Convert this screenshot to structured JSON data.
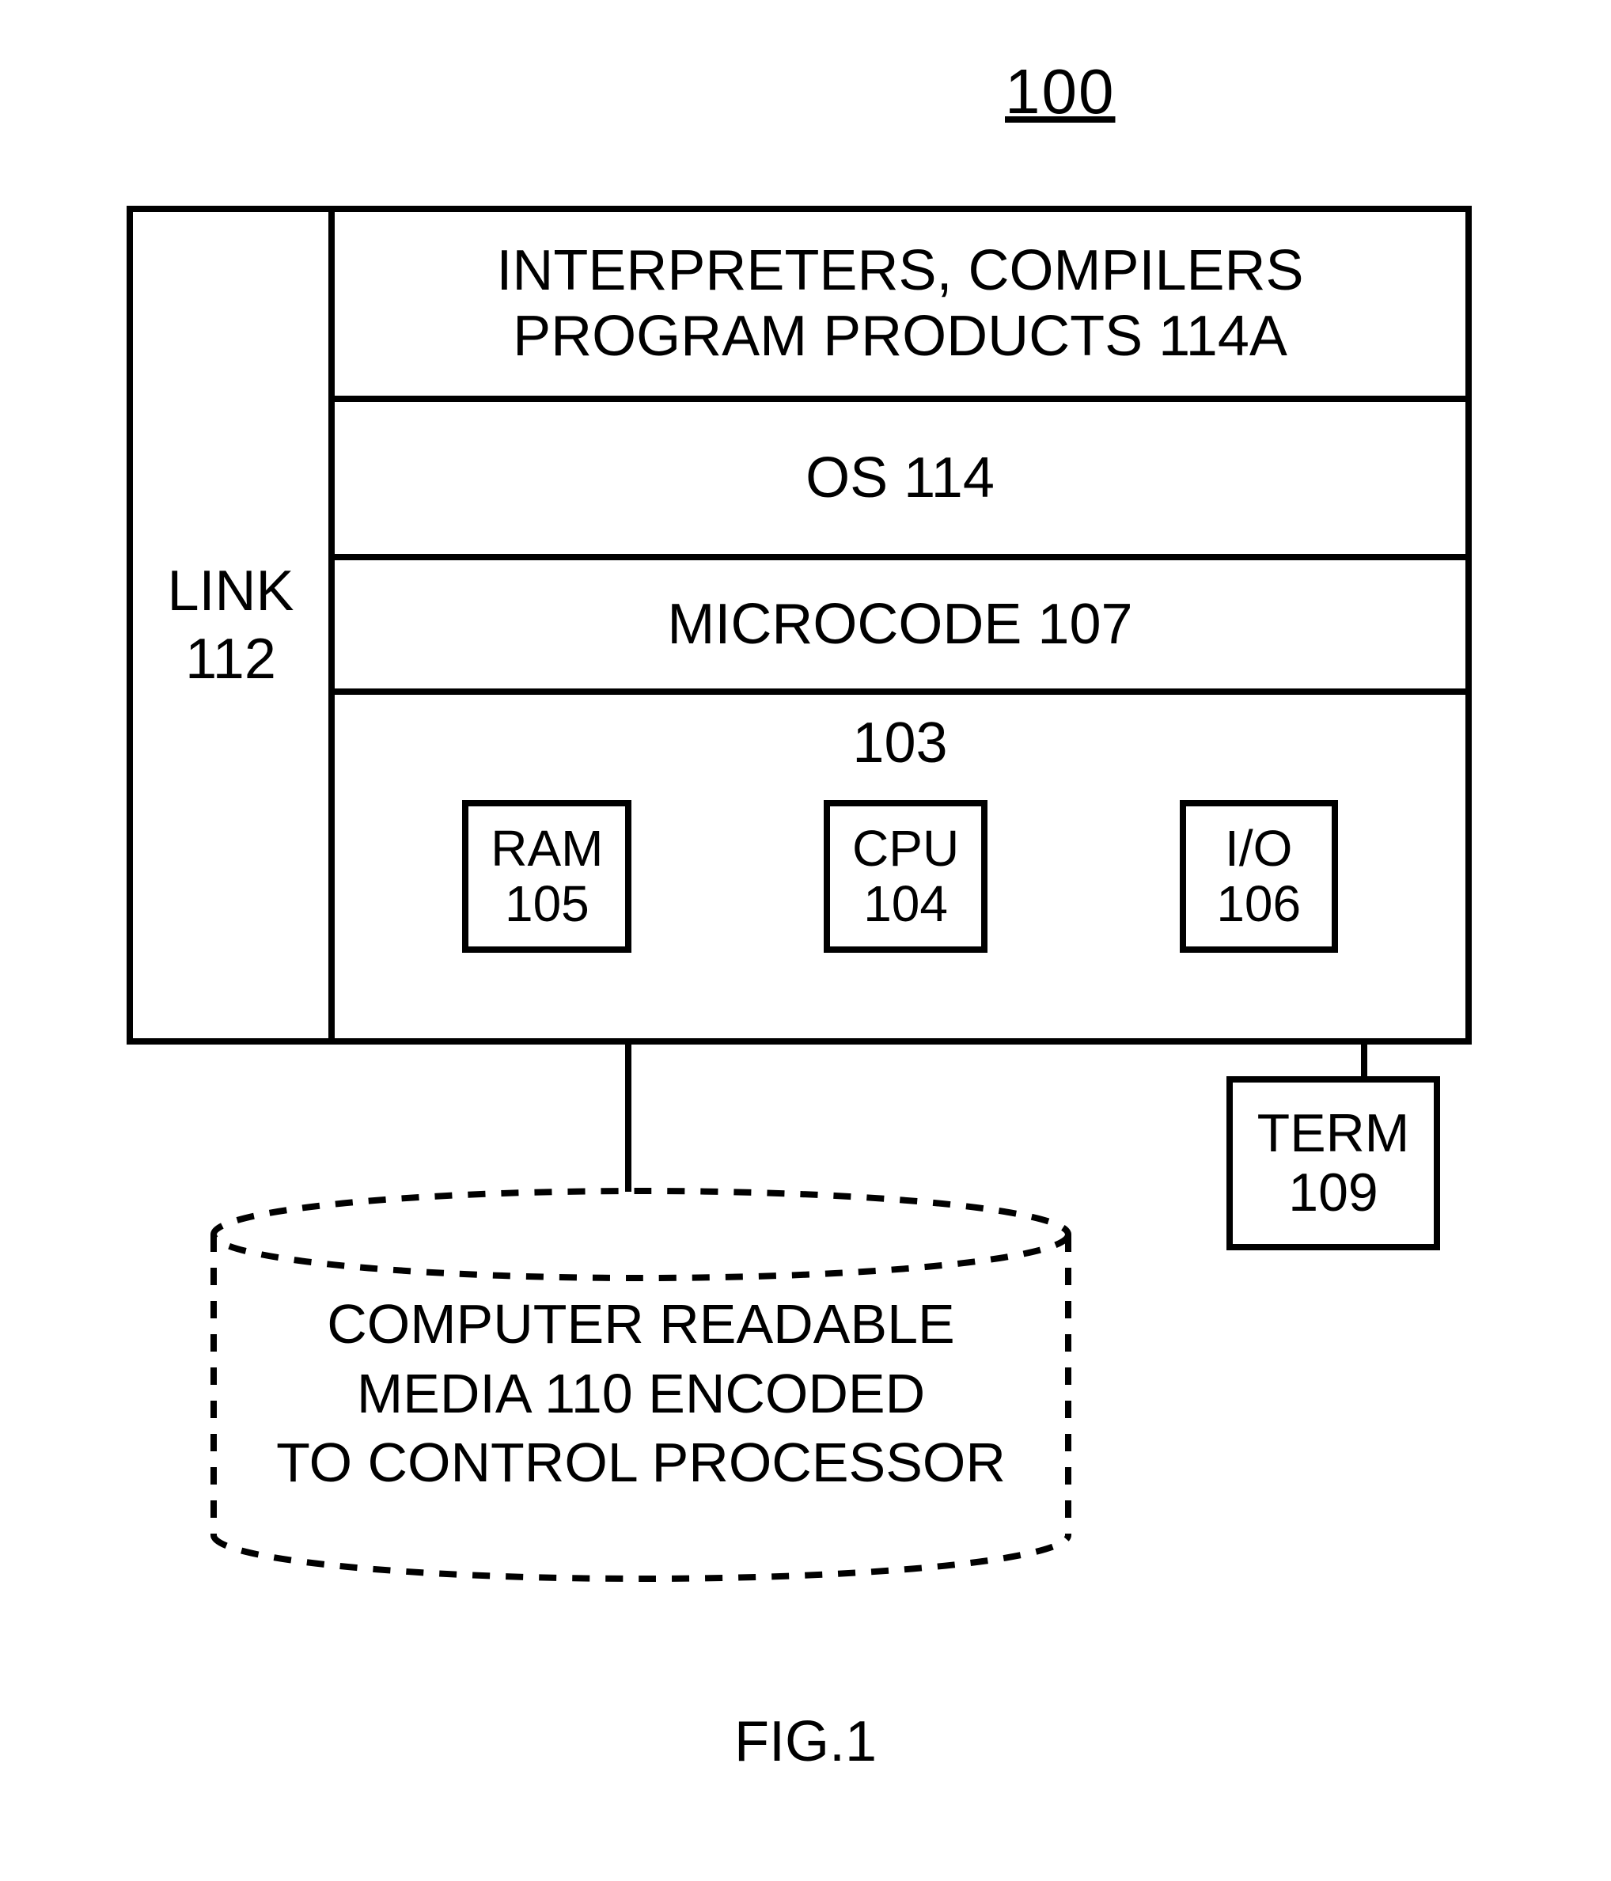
{
  "figure": {
    "system_ref": "100",
    "caption": "FIG.1"
  },
  "link": {
    "label": "LINK",
    "ref": "112"
  },
  "layers": {
    "apps": {
      "line1": "INTERPRETERS, COMPILERS",
      "line2": "PROGRAM PRODUCTS  114A"
    },
    "os": {
      "label": "OS   114"
    },
    "microcode": {
      "label": "MICROCODE 107"
    }
  },
  "hardware": {
    "ref": "103",
    "ram": {
      "label": "RAM",
      "ref": "105"
    },
    "cpu": {
      "label": "CPU",
      "ref": "104"
    },
    "io": {
      "label": "I/O",
      "ref": "106"
    }
  },
  "term": {
    "label": "TERM",
    "ref": "109"
  },
  "media": {
    "line1": "COMPUTER READABLE",
    "line2": "MEDIA  110 ENCODED",
    "line3": "TO CONTROL PROCESSOR"
  }
}
